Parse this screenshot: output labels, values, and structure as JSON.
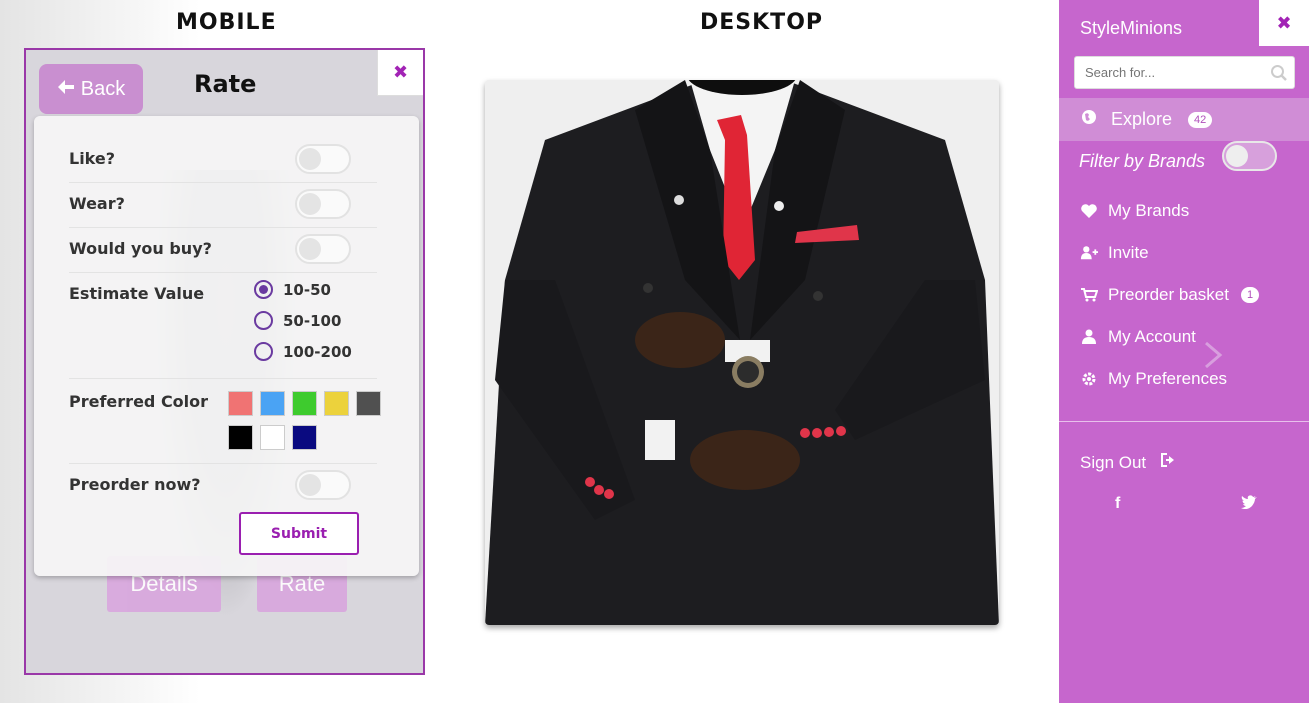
{
  "headings": {
    "mobile": "MOBILE",
    "desktop": "DESKTOP"
  },
  "mobile": {
    "back_label": "Back",
    "title": "Rate",
    "close_icon": "close-icon",
    "details_label": "Details",
    "rate_label": "Rate",
    "form": {
      "like_label": "Like?",
      "wear_label": "Wear?",
      "buy_label": "Would you buy?",
      "estimate_label": "Estimate Value",
      "estimate_options": [
        "10-50",
        "50-100",
        "100-200"
      ],
      "estimate_selected": "10-50",
      "color_label": "Preferred Color",
      "colors": [
        "#f07373",
        "#4aa3f4",
        "#3ecb2e",
        "#ecd23c",
        "#505050",
        "#000000",
        "#ffffff",
        "#0a0a80"
      ],
      "preorder_label": "Preorder now?",
      "submit_label": "Submit",
      "toggles": {
        "like": false,
        "wear": false,
        "buy": false,
        "preorder": false
      }
    }
  },
  "sidebar": {
    "brand": "StyleMinions",
    "search_placeholder": "Search for...",
    "explore": {
      "label": "Explore",
      "badge": "42"
    },
    "filter_label": "Filter by Brands",
    "filter_on": false,
    "items": [
      {
        "label": "My Brands",
        "icon": "heart-icon"
      },
      {
        "label": "Invite",
        "icon": "user-plus-icon"
      },
      {
        "label": "Preorder basket",
        "icon": "cart-icon",
        "badge": "1"
      },
      {
        "label": "My Account",
        "icon": "user-icon"
      },
      {
        "label": "My Preferences",
        "icon": "gear-icon"
      }
    ],
    "signout_label": "Sign Out",
    "social": [
      "f",
      "t"
    ]
  },
  "colors": {
    "accent": "#c666cd",
    "accent_dark": "#9a1fb0",
    "radio": "#6a3aa0"
  }
}
